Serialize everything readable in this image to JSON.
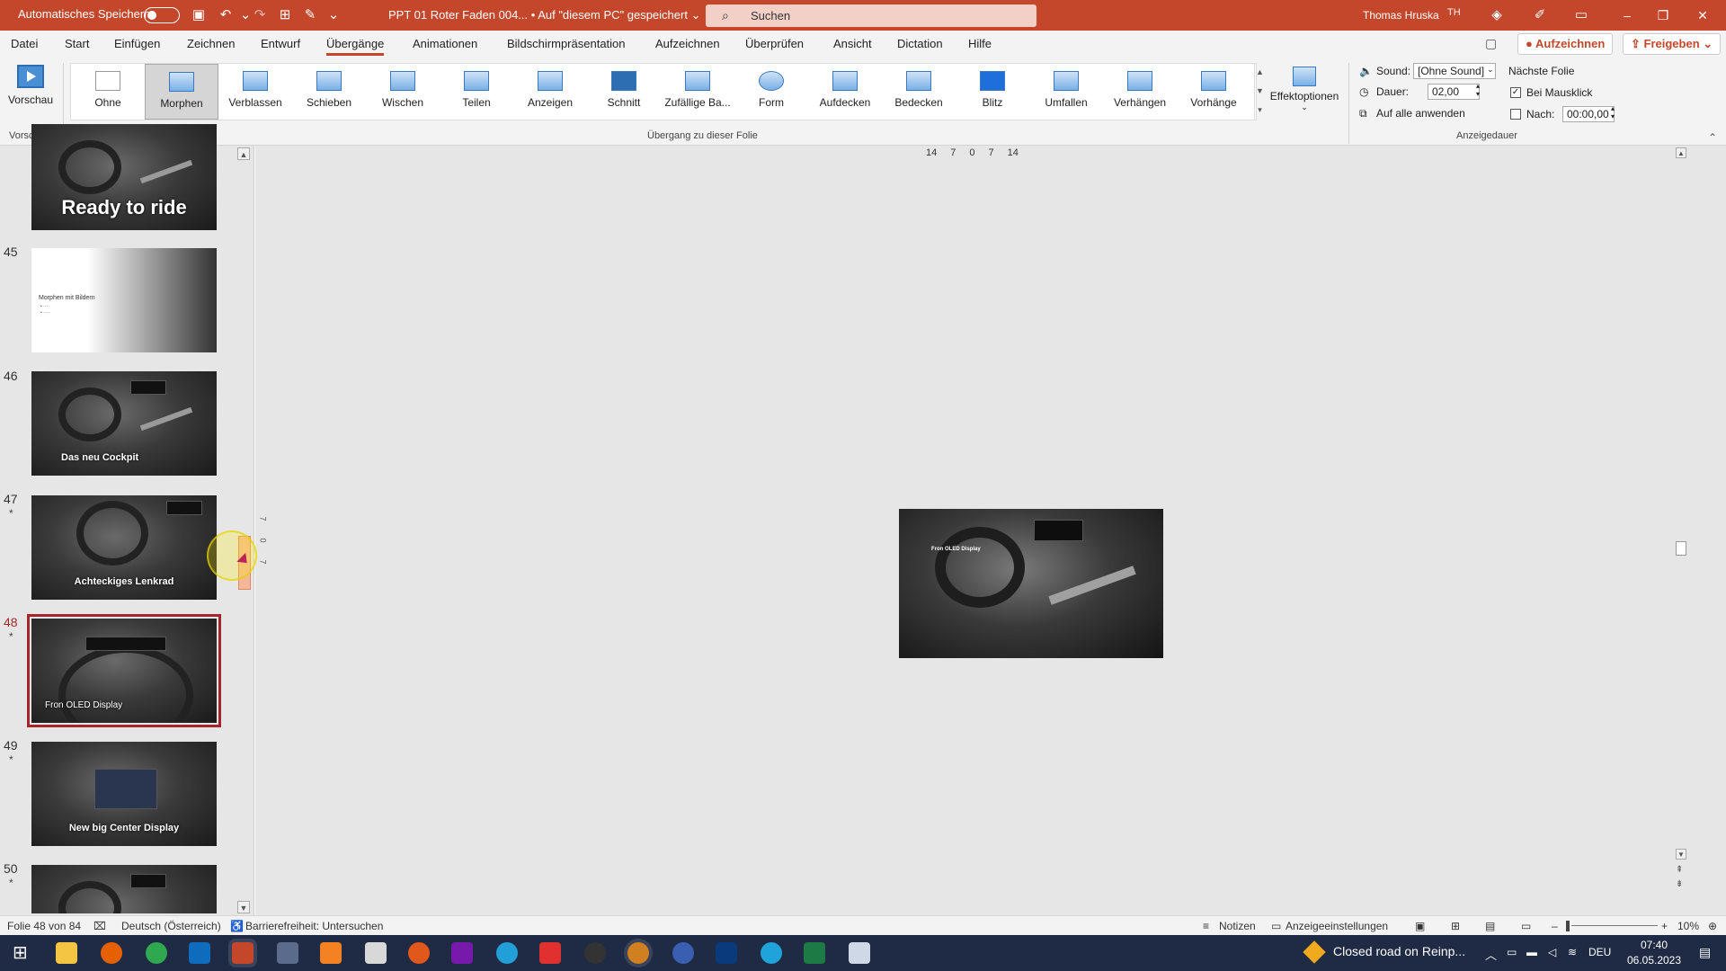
{
  "titlebar": {
    "autosave_label": "Automatisches Speichern",
    "doc_title": "PPT 01 Roter Faden 004... • Auf \"diesem PC\" gespeichert ⌄",
    "search_placeholder": "Suchen",
    "user_name": "Thomas Hruska",
    "user_initials": "TH",
    "accent_color": "#c4472b"
  },
  "menu": {
    "tabs": [
      "Datei",
      "Start",
      "Einfügen",
      "Zeichnen",
      "Entwurf",
      "Übergänge",
      "Animationen",
      "Bildschirmpräsentation",
      "Aufzeichnen",
      "Überprüfen",
      "Ansicht",
      "Dictation",
      "Hilfe"
    ],
    "active_tab": "Übergänge",
    "record_label": "Aufzeichnen",
    "share_label": "Freigeben"
  },
  "ribbon": {
    "preview_label": "Vorschau",
    "preview_group": "Vorschau",
    "transitions": [
      "Ohne",
      "Morphen",
      "Verblassen",
      "Schieben",
      "Wischen",
      "Teilen",
      "Anzeigen",
      "Schnitt",
      "Zufällige Ba...",
      "Form",
      "Aufdecken",
      "Bedecken",
      "Blitz",
      "Umfallen",
      "Verhängen",
      "Vorhänge"
    ],
    "selected_transition": "Morphen",
    "effect_options_label": "Effektoptionen",
    "transition_group": "Übergang zu dieser Folie",
    "sound_label": "Sound:",
    "sound_value": "[Ohne Sound]",
    "duration_label": "Dauer:",
    "duration_value": "02,00",
    "apply_all_label": "Auf alle anwenden",
    "next_slide_label": "Nächste Folie",
    "on_click_label": "Bei Mausklick",
    "on_click_checked": true,
    "after_label": "Nach:",
    "after_checked": false,
    "after_value": "00:00,00",
    "timing_group": "Anzeigedauer"
  },
  "slides": [
    {
      "num": "",
      "caption": "Ready to ride",
      "starred": false,
      "selected": false,
      "style": "dark-big"
    },
    {
      "num": "45",
      "caption": "",
      "subtitle": "Morphen mit Bildern",
      "starred": false,
      "selected": false,
      "style": "light"
    },
    {
      "num": "46",
      "caption": "Das neu Cockpit",
      "starred": false,
      "selected": false,
      "style": "dark"
    },
    {
      "num": "47",
      "caption": "Achteckiges Lenkrad",
      "starred": true,
      "selected": false,
      "style": "dark"
    },
    {
      "num": "48",
      "caption": "Fron OLED Display",
      "starred": true,
      "selected": true,
      "style": "dark"
    },
    {
      "num": "49",
      "caption": "New big Center Display",
      "starred": true,
      "selected": false,
      "style": "dark"
    },
    {
      "num": "50",
      "caption": "",
      "starred": true,
      "selected": false,
      "style": "dark"
    }
  ],
  "ruler": {
    "horizontal": [
      "14",
      "7",
      "0",
      "7",
      "14"
    ],
    "vertical": [
      "7",
      "0",
      "7"
    ]
  },
  "main_slide": {
    "caption": "Fron OLED Display"
  },
  "statusbar": {
    "slide_info": "Folie 48 von 84",
    "language": "Deutsch (Österreich)",
    "accessibility": "Barrierefreiheit: Untersuchen",
    "notes_label": "Notizen",
    "display_settings": "Anzeigeeinstellungen",
    "zoom": "10%"
  },
  "taskbar": {
    "notification": "Closed road on Reinp...",
    "language": "DEU",
    "time": "07:40",
    "date": "06.05.2023"
  }
}
